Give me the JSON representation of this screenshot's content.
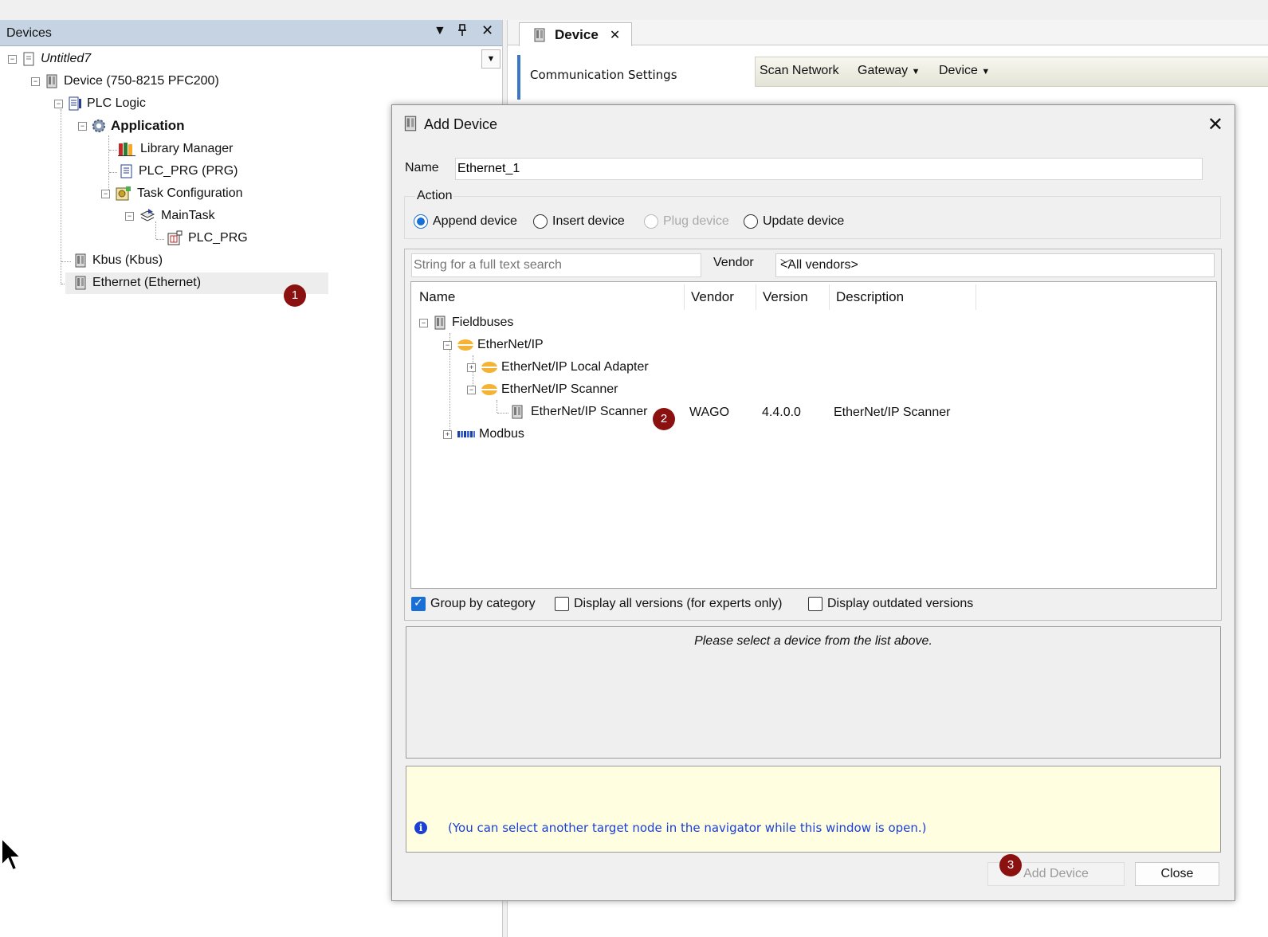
{
  "devices_panel": {
    "title": "Devices",
    "pin_glyph": "📌",
    "tree": [
      {
        "label": "Untitled7",
        "icon": "project-icon"
      },
      {
        "label": "Device (750-8215 PFC200)",
        "icon": "device-icon"
      },
      {
        "label": "PLC Logic",
        "icon": "plc-logic-icon"
      },
      {
        "label": "Application",
        "icon": "application-gear-icon"
      },
      {
        "label": "Library Manager",
        "icon": "library-icon"
      },
      {
        "label": "PLC_PRG (PRG)",
        "icon": "program-icon"
      },
      {
        "label": "Task Configuration",
        "icon": "task-config-icon"
      },
      {
        "label": "MainTask",
        "icon": "task-icon"
      },
      {
        "label": "PLC_PRG",
        "icon": "program-call-icon"
      },
      {
        "label": "Kbus (Kbus)",
        "icon": "device-icon"
      },
      {
        "label": "Ethernet (Ethernet)",
        "icon": "device-icon"
      }
    ]
  },
  "badges": {
    "one": "1",
    "two": "2",
    "three": "3"
  },
  "editor": {
    "tab_label": "Device",
    "comm_settings": "Communication Settings",
    "toolbar": {
      "scan": "Scan Network",
      "gateway": "Gateway",
      "device": "Device"
    }
  },
  "dialog": {
    "title": "Add Device",
    "name_label": "Name",
    "name_value": "Ethernet_1",
    "action_legend": "Action",
    "actions": [
      "Append device",
      "Insert device",
      "Plug device",
      "Update device"
    ],
    "selected_action": "Append device",
    "search_placeholder": "String for a full text search",
    "vendor_label": "Vendor",
    "vendor_value": "<All vendors>",
    "columns": [
      "Name",
      "Vendor",
      "Version",
      "Description"
    ],
    "device_tree": [
      {
        "name": "Fieldbuses",
        "vendor": "",
        "version": "",
        "description": ""
      },
      {
        "name": "EtherNet/IP",
        "vendor": "",
        "version": "",
        "description": ""
      },
      {
        "name": "EtherNet/IP Local Adapter",
        "vendor": "",
        "version": "",
        "description": ""
      },
      {
        "name": "EtherNet/IP Scanner",
        "vendor": "",
        "version": "",
        "description": ""
      },
      {
        "name": "EtherNet/IP Scanner",
        "vendor": "WAGO",
        "version": "4.4.0.0",
        "description": "EtherNet/IP Scanner"
      },
      {
        "name": "Modbus",
        "vendor": "",
        "version": "",
        "description": ""
      }
    ],
    "checkboxes": [
      {
        "label": "Group by category",
        "checked": true
      },
      {
        "label": "Display all versions (for experts only)",
        "checked": false
      },
      {
        "label": "Display outdated versions",
        "checked": false
      }
    ],
    "info_text": "Please select a device from the list above.",
    "hint_text": "(You can select another target node in the navigator while this window is open.)",
    "add_button": "Add Device",
    "close_button": "Close"
  }
}
